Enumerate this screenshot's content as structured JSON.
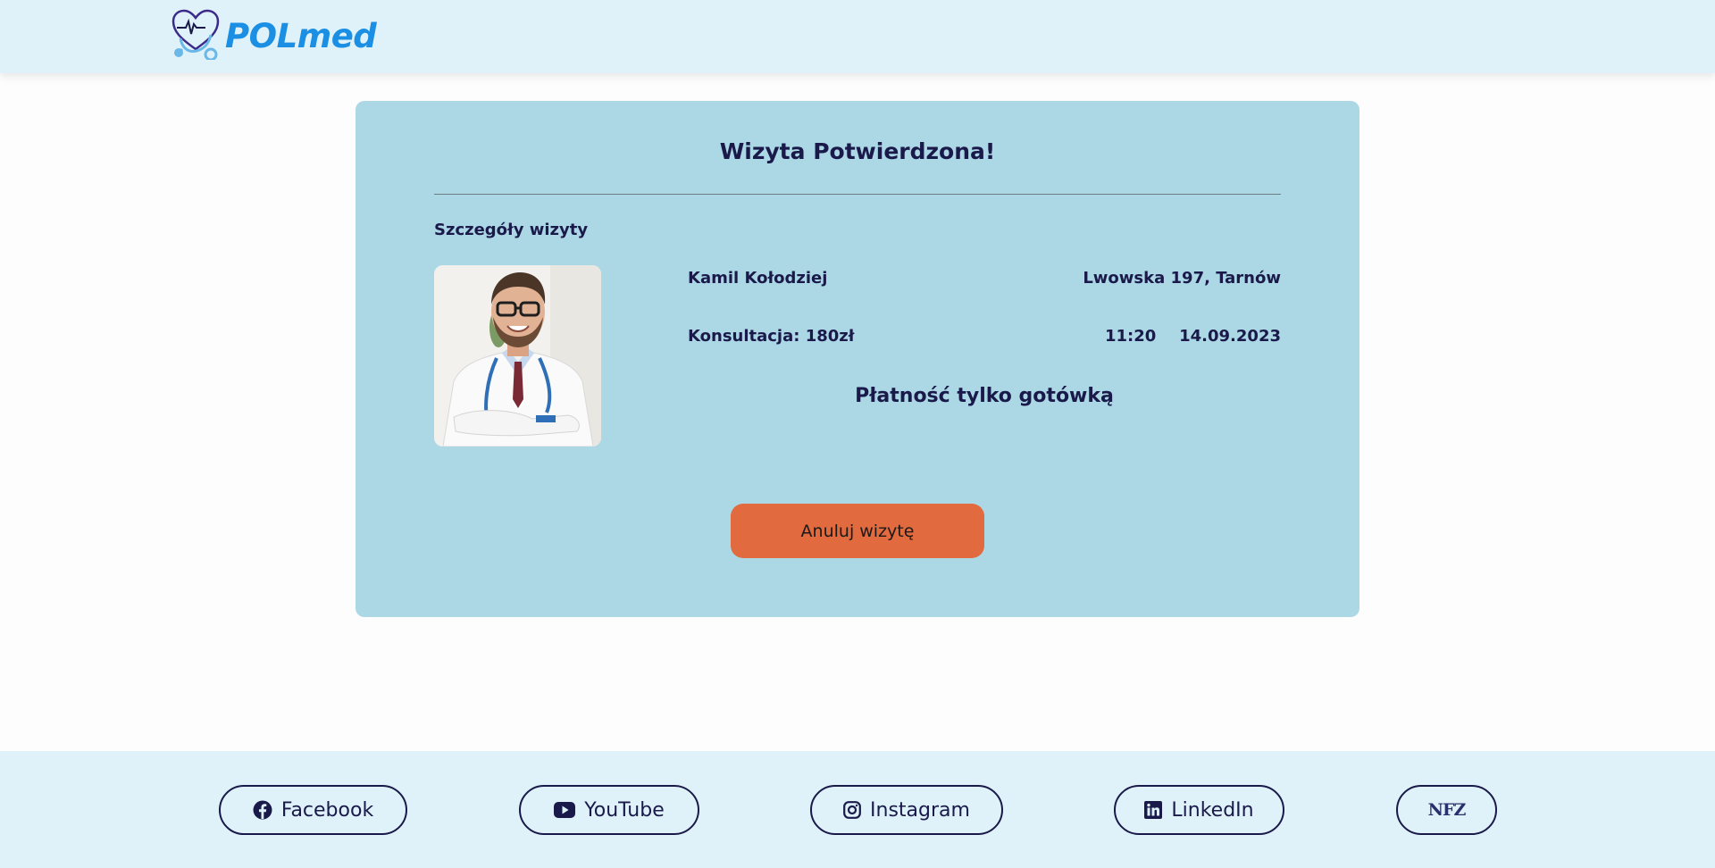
{
  "header": {
    "logo_text": "POLmed"
  },
  "card": {
    "title": "Wizyta Potwierdzona!",
    "section_label": "Szczegóły wizyty",
    "doctor_name": "Kamil Kołodziej",
    "address": "Lwowska 197, Tarnów",
    "price": "Konsultacja: 180zł",
    "time": "11:20",
    "date": "14.09.2023",
    "payment_note": "Płatność tylko gotówką",
    "cancel_label": "Anuluj wizytę"
  },
  "footer": {
    "links": [
      {
        "label": "Facebook",
        "icon": "facebook-icon"
      },
      {
        "label": "YouTube",
        "icon": "youtube-icon"
      },
      {
        "label": "Instagram",
        "icon": "instagram-icon"
      },
      {
        "label": "LinkedIn",
        "icon": "linkedin-icon"
      },
      {
        "label": "NFZ",
        "icon": "nfz-logo"
      }
    ]
  },
  "colors": {
    "header_bg": "#dff2f9",
    "card_bg": "#acd7e5",
    "brand_blue": "#1b8fe4",
    "cancel_button": "#e26a3f",
    "text_dark": "#1a1a4a"
  }
}
